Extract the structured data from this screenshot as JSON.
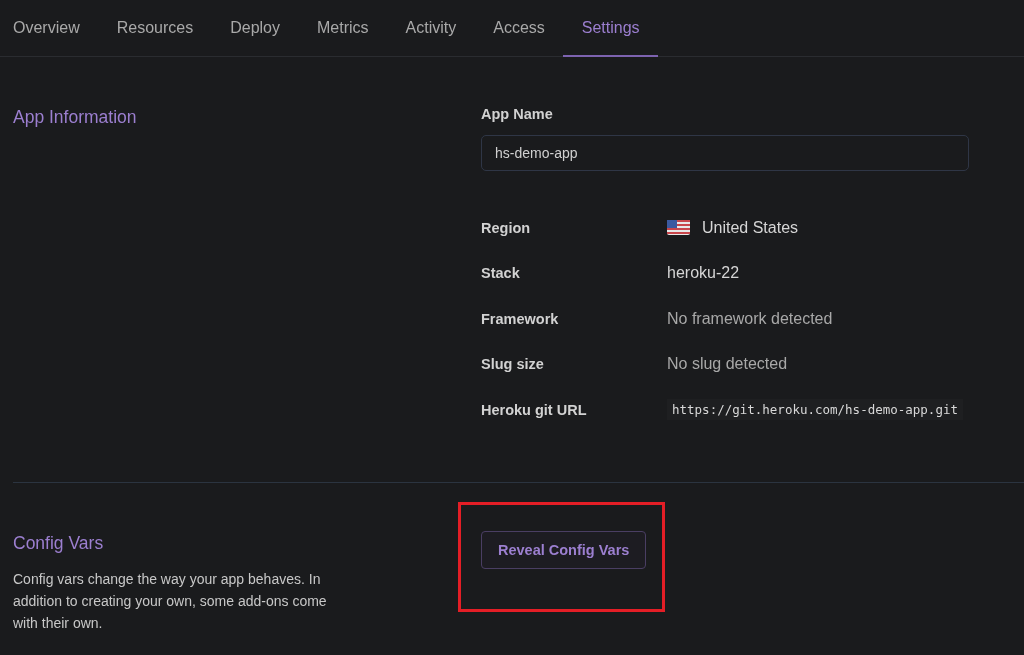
{
  "tabs": [
    {
      "label": "Overview",
      "selected": false
    },
    {
      "label": "Resources",
      "selected": false
    },
    {
      "label": "Deploy",
      "selected": false
    },
    {
      "label": "Metrics",
      "selected": false
    },
    {
      "label": "Activity",
      "selected": false
    },
    {
      "label": "Access",
      "selected": false
    },
    {
      "label": "Settings",
      "selected": true
    }
  ],
  "app_information": {
    "title": "App Information",
    "app_name": {
      "label": "App Name",
      "value": "hs-demo-app"
    },
    "details": [
      {
        "kind": "flag",
        "label": "Region",
        "value": "United States"
      },
      {
        "kind": "text",
        "label": "Stack",
        "value": "heroku-22"
      },
      {
        "kind": "muted",
        "label": "Framework",
        "value": "No framework detected"
      },
      {
        "kind": "muted",
        "label": "Slug size",
        "value": "No slug detected"
      },
      {
        "kind": "code",
        "label": "Heroku git URL",
        "value": "https://git.heroku.com/hs-demo-app.git"
      }
    ]
  },
  "config_vars": {
    "title": "Config Vars",
    "description": "Config vars change the way your app behaves. In addition to creating your own, some add-ons come with their own.",
    "button": {
      "label": "Reveal Config Vars",
      "highlighted": true
    }
  }
}
